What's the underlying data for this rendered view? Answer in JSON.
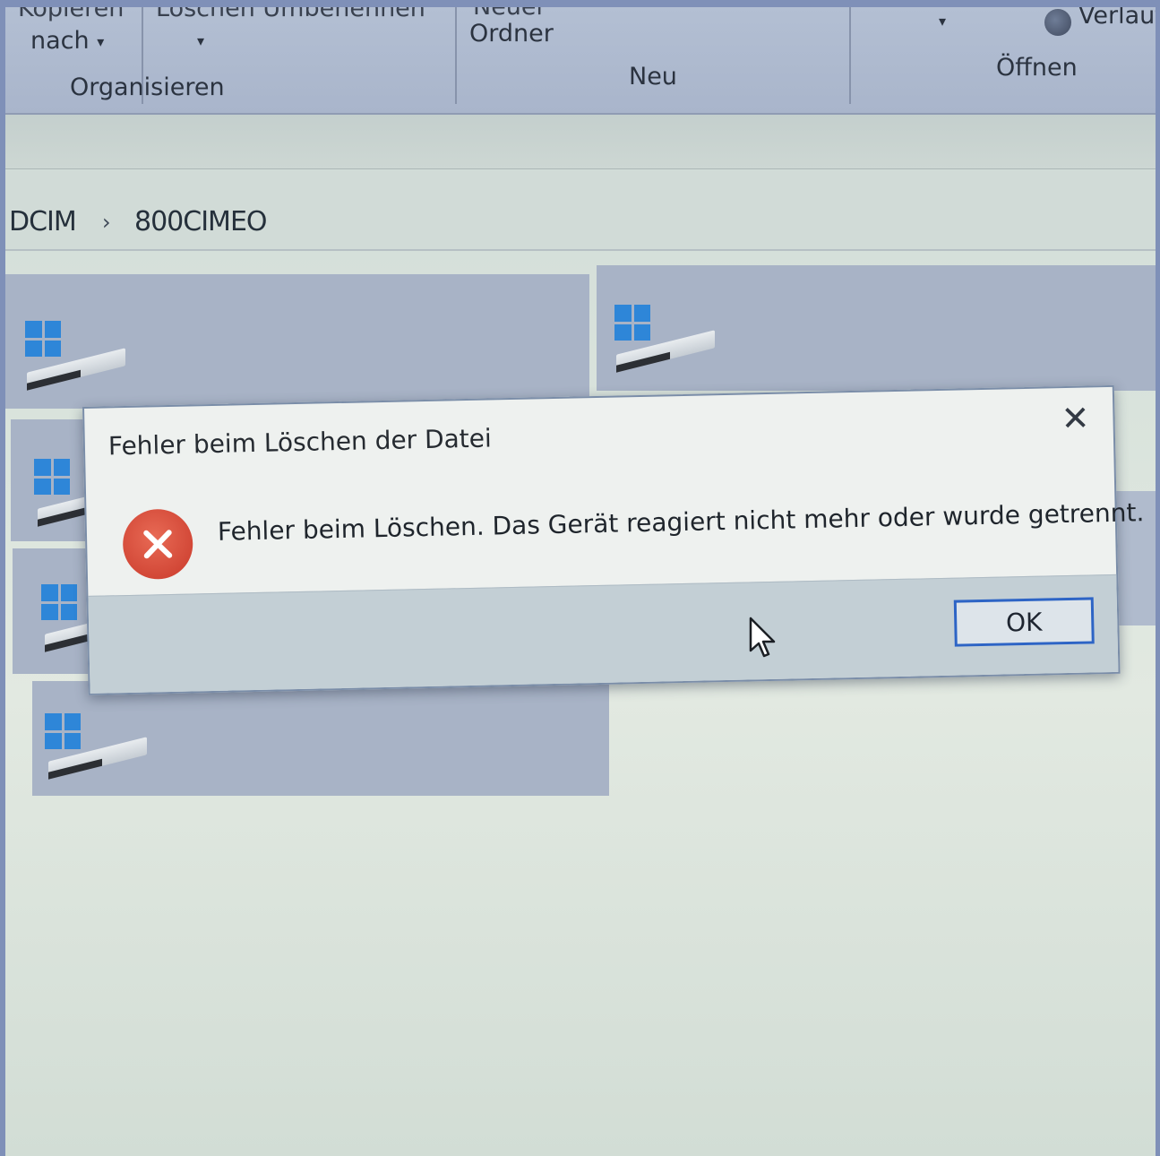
{
  "ribbon": {
    "kopieren_nach_top": "Kopieren",
    "kopieren_nach_bottom": "nach",
    "loeschen_umbenennen": "Löschen Umbenennen",
    "organisieren": "Organisieren",
    "neuer_ordner_top": "Neuer",
    "neuer_ordner_bottom": "Ordner",
    "neu": "Neu",
    "verlauf": "Verlauf",
    "oeffnen": "Öffnen",
    "dropdown_caret": "▾"
  },
  "breadcrumb": {
    "items": [
      "DCIM",
      "800CIMEO"
    ],
    "separator": "›"
  },
  "dialog": {
    "title": "Fehler beim Löschen der Datei",
    "message": "Fehler beim Löschen. Das Gerät reagiert nicht mehr oder wurde getrennt.",
    "ok_label": "OK",
    "close_glyph": "✕",
    "icon": "error-icon"
  },
  "colors": {
    "accent": "#2d64c5",
    "error": "#d2412f",
    "windows_blue": "#2e86d8"
  }
}
